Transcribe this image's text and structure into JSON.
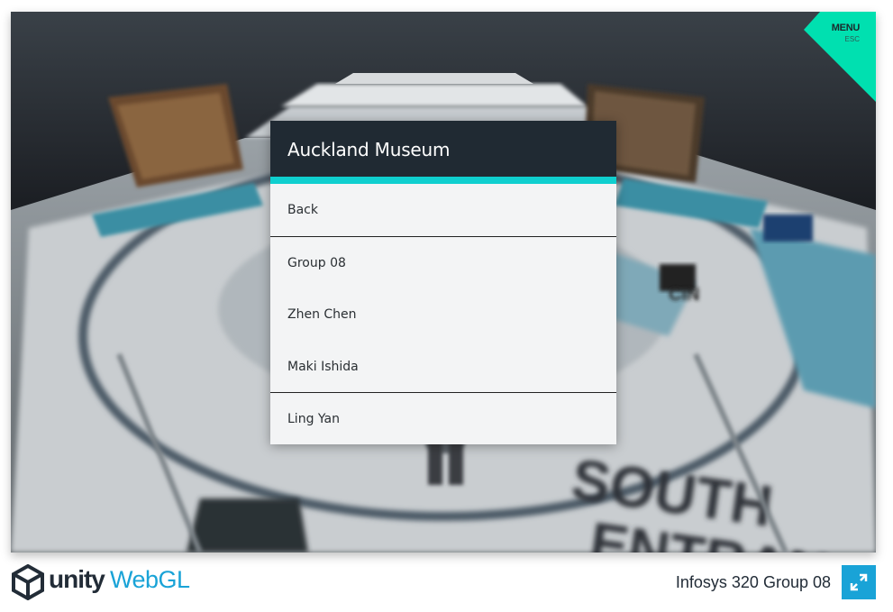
{
  "app": {
    "menu_label": "MENU",
    "menu_shortcut": "ESC",
    "accent_color": "#0fcfcf",
    "menu_corner_color": "#00e0b0"
  },
  "dialog": {
    "title": "Auckland Museum",
    "items": [
      {
        "label": "Back"
      },
      {
        "label": "Group 08"
      },
      {
        "label": "Zhen Chen"
      },
      {
        "label": "Maki Ishida"
      },
      {
        "label": "Ling Yan"
      }
    ]
  },
  "footer": {
    "unity_label": "unity",
    "webgl_label": "WebGL",
    "build_title": "Infosys 320 Group 08",
    "fullscreen_icon": "fullscreen-icon",
    "brand_color": "#19a3d7"
  }
}
